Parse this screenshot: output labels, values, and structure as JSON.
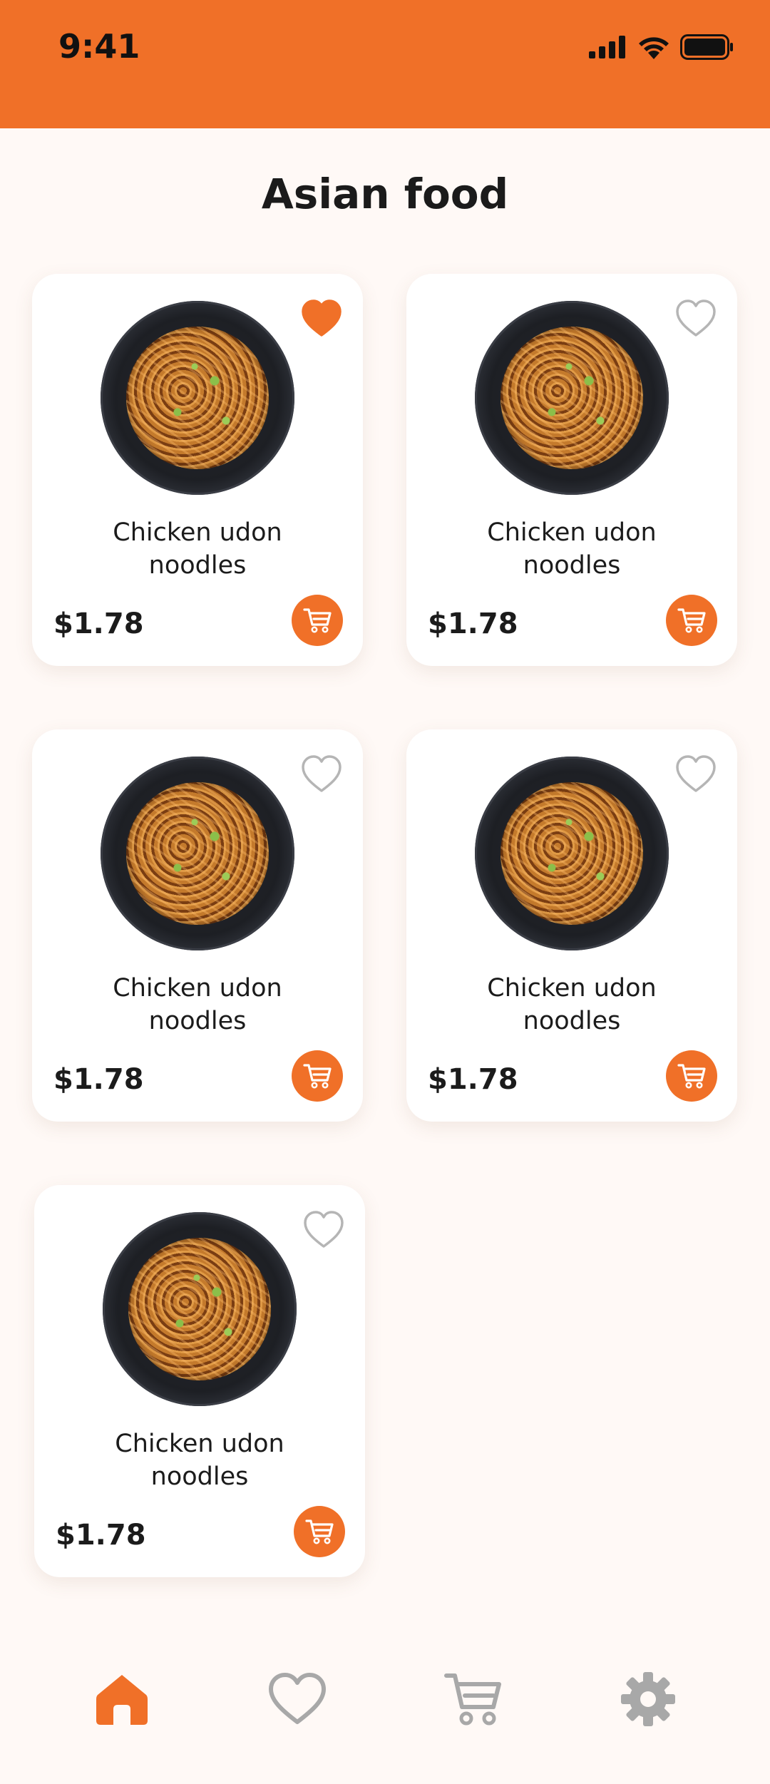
{
  "status_bar": {
    "time": "9:41"
  },
  "page": {
    "title": "Asian food"
  },
  "colors": {
    "accent": "#F07028",
    "background": "#FFF9F6",
    "icon_inactive": "#A8A8A8"
  },
  "products": [
    {
      "name": "Chicken udon noodles",
      "price": "$1.78",
      "favorited": true
    },
    {
      "name": "Chicken udon noodles",
      "price": "$1.78",
      "favorited": false
    },
    {
      "name": "Chicken udon noodles",
      "price": "$1.78",
      "favorited": false
    },
    {
      "name": "Chicken udon noodles",
      "price": "$1.78",
      "favorited": false
    },
    {
      "name": "Chicken udon noodles",
      "price": "$1.78",
      "favorited": false
    }
  ],
  "tab_bar": {
    "tabs": [
      {
        "icon": "home-icon",
        "active": true
      },
      {
        "icon": "heart-icon",
        "active": false
      },
      {
        "icon": "cart-icon",
        "active": false
      },
      {
        "icon": "gear-icon",
        "active": false
      }
    ]
  }
}
